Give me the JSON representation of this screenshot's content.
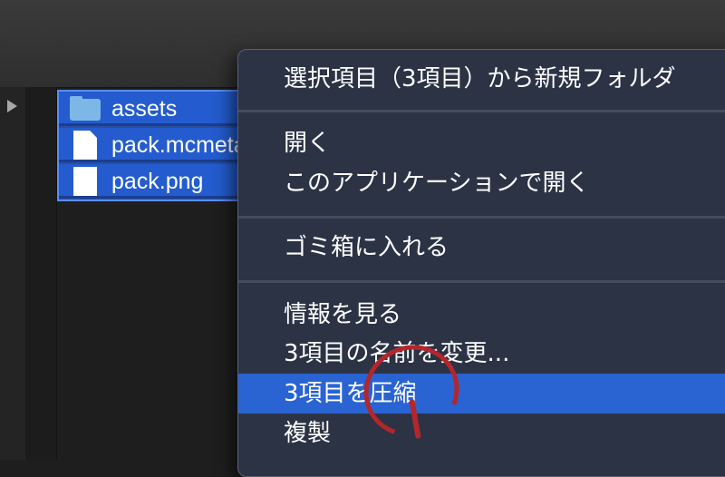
{
  "finder": {
    "files": [
      {
        "icon": "folder-icon",
        "name": "assets"
      },
      {
        "icon": "document-icon",
        "name": "pack.mcmeta"
      },
      {
        "icon": "image-file-icon",
        "name": "pack.png"
      }
    ]
  },
  "context_menu": {
    "items": [
      {
        "label": "選択項目（3項目）から新規フォルダ"
      },
      {
        "label": "開く"
      },
      {
        "label": "このアプリケーションで開く"
      },
      {
        "label": "ゴミ箱に入れる"
      },
      {
        "label": "情報を見る"
      },
      {
        "label": "3項目の名前を変更..."
      },
      {
        "label": "3項目を圧縮",
        "highlighted": true
      },
      {
        "label": "複製"
      }
    ]
  },
  "annotation": {
    "color": "#b3262c"
  },
  "colors": {
    "selection": "#245ccf",
    "menu_highlight": "#2a63d2"
  }
}
